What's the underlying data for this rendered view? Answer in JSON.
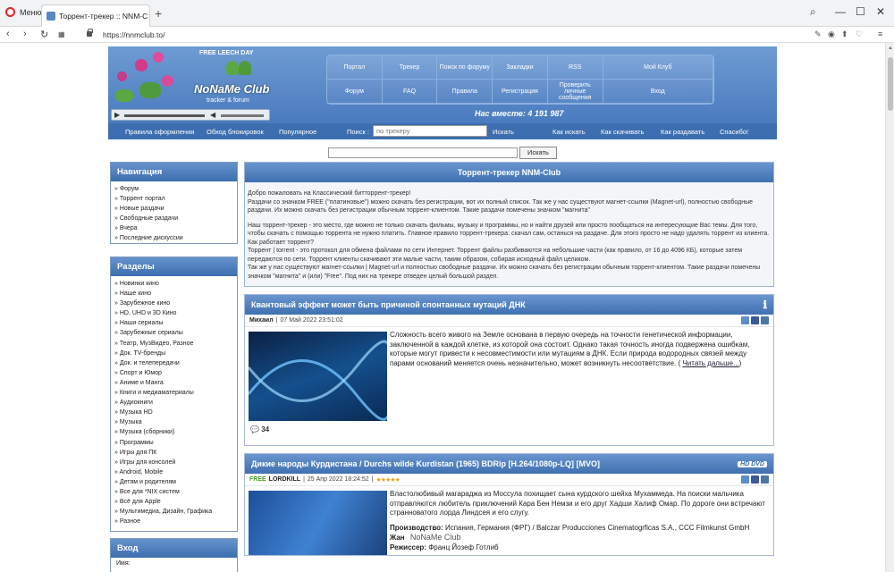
{
  "browser": {
    "menu_label": "Меню",
    "tab_title": "Торрент-трекер :: NNM-C",
    "url": "https://nnmclub.to/"
  },
  "header": {
    "free_leech": "FREE LEECH DAY",
    "logo_title": "NoNaMe Club",
    "logo_sub": "tracker & forum",
    "together": "Нас вместе: 4 191 987",
    "grid": [
      "Портал",
      "Трекер",
      "Поиск по форуму",
      "Закладки",
      "RSS",
      "Мой Клуб",
      "",
      "Форум",
      "FAQ",
      "Правила",
      "Регистрация",
      "Проверить личные сообщения",
      "",
      "Вход"
    ]
  },
  "subnav": {
    "items": [
      "Правила оформления",
      "Обход блокировок",
      "Популярное"
    ],
    "search_label": "Поиск :",
    "search_placeholder": "по трекеру",
    "search_btn": "Искать",
    "right_items": [
      "Как искать",
      "Как скачивать",
      "Как раздавать",
      "Спасибо!"
    ]
  },
  "big_search": {
    "button": "Искать"
  },
  "sidebar": {
    "nav_title": "Навигация",
    "nav_items": [
      "Форум",
      "Торрент портал",
      "Новые раздачи",
      "Свободные раздачи",
      "Вчера",
      "Последние дискуссии"
    ],
    "sections_title": "Разделы",
    "sections": [
      "Новинки кино",
      "Наше кино",
      "Зарубежное кино",
      "HD, UHD и 3D Кино",
      "Наши сериалы",
      "Зарубежные сериалы",
      "Театр, МузВидео, Разное",
      "Док. TV-бренды",
      "Док. и телепередачи",
      "Спорт и Юмор",
      "Аниме и Манга",
      "Книги и медиаматериалы",
      "Аудиокниги",
      "Музыка HD",
      "Музыка",
      "Музыка (сборники)",
      "Программы",
      "Игры для ПК",
      "Игры для консолей",
      "Android, Mobile",
      "Детям и родителям",
      "Все для *NIX систем",
      "Всё для Apple",
      "Мультимедиа, Дизайн, Графика",
      "Разное"
    ],
    "login_title": "Вход",
    "login_name": "Имя:"
  },
  "welcome": {
    "title": "Торрент-трекер NNM-Club",
    "p1": "Добро пожаловать на Классический битторрент-трекер!",
    "p2": "Раздачи со значком FREE (\"платиновые\") можно скачать без регистрации, вот их полный список. Так же у нас существуют магнет-ссылки (Magnet-url), полностью свободные раздачи. Их можно скачать без регистрации обычным торрент-клиентом. Такие раздачи помечены значком \"магнита\"",
    "p3": "Наш торрент-трекер - это место, где можно не только скачать фильмы, музыку и программы, но и найти друзей или просто пообщаться на интересующие Вас темы. Для того, чтобы скачать с помощью торрента не нужно платить. Главное правило торрент-трекера: скачал сам, останься на раздаче. Для этого просто не надо удалять торрент из клиента.",
    "p4": "Как работает торрент?",
    "p5": "Торрент | torrent - это протокол для обмена файлами по сети Интернет. Торрент файлы разбиваются на небольшие части (как правило, от 16 до 4096 КБ), которые затем передаются по сети. Торрент клиенты скачивают эти малые части, таким образом, собирая исходный файл целиком.",
    "p6": "Так же у нас существуют магнет-ссылки | Magnet-url и полностью свободные раздачи. Их можно скачать без регистрации обычным торрент-клиентом. Такие раздачи помечены значком \"магнита\" и (или) \"Free\". Под них на трекере отведен целый большой раздел."
  },
  "news1": {
    "title": "Квантовый эффект может быть причиной спонтанных мутаций ДНК",
    "author": "Михаил",
    "date": "07 Май 2022 23:51:02",
    "text": "Сложность всего живого на Земле основана в первую очередь на точности генетической информации, заключенной в каждой клетке, из которой она состоит. Однако такая точность иногда подвержена ошибкам, которые могут привести к несовместимости или мутациям в ДНК. Если природа водородных связей между парами оснований меняется очень незначительно, может возникнуть несоответствие. (",
    "more": "Читать дальше...",
    "more_end": ")",
    "comments": "34"
  },
  "news2": {
    "title": "Дикие народы Курдистана / Durchs wilde Kurdistan (1965) BDRip [H.264/1080p-LQ] [MVO]",
    "hd": "HD DVD",
    "free": "FREE",
    "author": "LORDKILL",
    "date": "25 Апр 2022 18:24:52",
    "stars": "★★★★★",
    "text": "Властолюбивый магараджа из Моссула похищает сына курдского шейха Мухаммеда. На поиски мальчика отправляются любитель приключений Кара Бен Немзи и его друг Хадши Халиф Омар. По дороге они встречают странноватого лорда Линдсея и его слугу.",
    "prod_label": "Производство:",
    "prod": "Испания, Германия (ФРГ) / Balczar Producciones Cinematogrficas S.A., CCC Filmkunst GmbH",
    "genre_label": "Жан",
    "director_label": "Режиссер:",
    "director": "Франц Йозеф Готлиб",
    "watermark": "NoNaMe Club"
  }
}
